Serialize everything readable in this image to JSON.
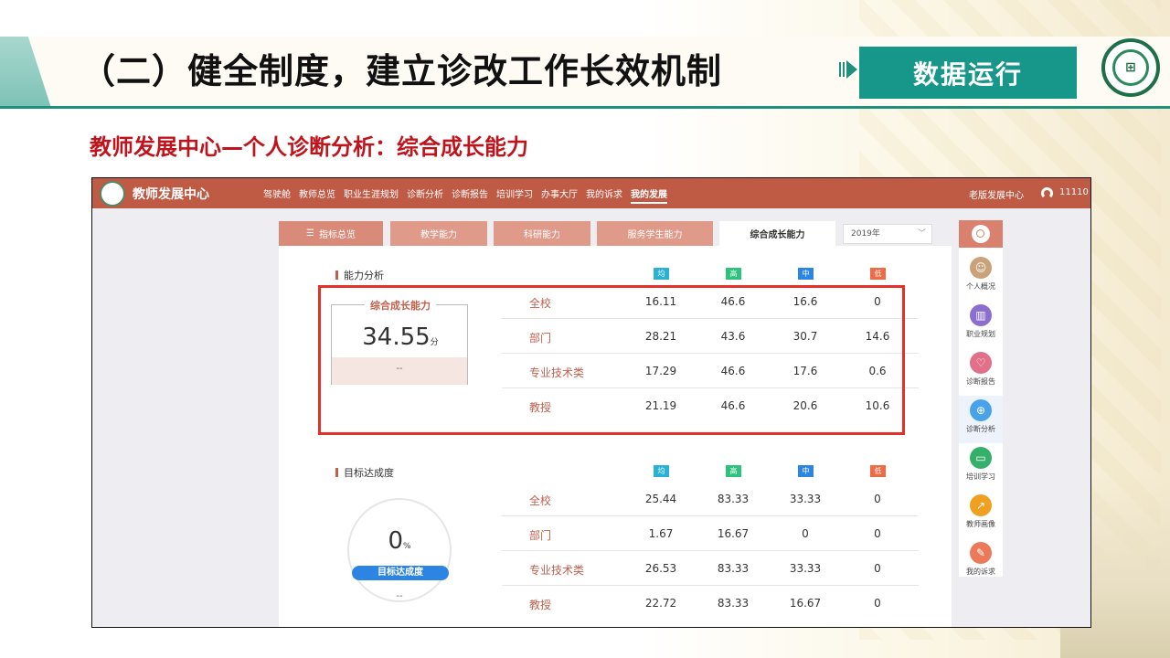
{
  "slide": {
    "title": "（二）健全制度，建立诊改工作长效机制",
    "badge": "数据运行",
    "subtitle": "教师发展中心—个人诊断分析：综合成长能力"
  },
  "app": {
    "name": "教师发展中心",
    "nav": [
      "驾驶舱",
      "教师总览",
      "职业生涯规划",
      "诊断分析",
      "诊断报告",
      "培训学习",
      "办事大厅",
      "我的诉求",
      "我的发展"
    ],
    "nav_active": "我的发展",
    "old_version": "老版发展中心",
    "user_id": "11110"
  },
  "tabs": {
    "overview": "指标总览",
    "items": [
      "教学能力",
      "科研能力",
      "服务学生能力",
      "综合成长能力"
    ],
    "active": "综合成长能力",
    "year": "2019年"
  },
  "legend": {
    "avg": "均",
    "high": "高",
    "mid": "中",
    "low": "低",
    "colors": {
      "avg": "#2bb0d6",
      "high": "#2ec27e",
      "mid": "#2d85e3",
      "low": "#ef6b46"
    }
  },
  "ability": {
    "section_title": "能力分析",
    "box_title": "综合成长能力",
    "score": "34.55",
    "unit": "分",
    "footnote": "--",
    "rows": [
      {
        "label": "全校",
        "avg": "16.11",
        "high": "46.6",
        "mid": "16.6",
        "low": "0"
      },
      {
        "label": "部门",
        "avg": "28.21",
        "high": "43.6",
        "mid": "30.7",
        "low": "14.6"
      },
      {
        "label": "专业技术类",
        "avg": "17.29",
        "high": "46.6",
        "mid": "17.6",
        "low": "0.6"
      },
      {
        "label": "教授",
        "avg": "21.19",
        "high": "46.6",
        "mid": "20.6",
        "low": "10.6"
      }
    ]
  },
  "goal": {
    "section_title": "目标达成度",
    "value": "0",
    "unit": "%",
    "pill": "目标达成度",
    "footnote": "--",
    "rows": [
      {
        "label": "全校",
        "avg": "25.44",
        "high": "83.33",
        "mid": "33.33",
        "low": "0"
      },
      {
        "label": "部门",
        "avg": "1.67",
        "high": "16.67",
        "mid": "0",
        "low": "0"
      },
      {
        "label": "专业技术类",
        "avg": "26.53",
        "high": "83.33",
        "mid": "33.33",
        "low": "0"
      },
      {
        "label": "教授",
        "avg": "22.72",
        "high": "83.33",
        "mid": "16.67",
        "low": "0"
      }
    ]
  },
  "sidebar": {
    "items": [
      {
        "label": "个人概况",
        "icon": "person-icon",
        "color": "#c9a27a"
      },
      {
        "label": "职业规划",
        "icon": "book-icon",
        "color": "#8a6fd1"
      },
      {
        "label": "诊断报告",
        "icon": "heart-icon",
        "color": "#e2708a"
      },
      {
        "label": "诊断分析",
        "icon": "target-icon",
        "color": "#4aa3e8"
      },
      {
        "label": "培训学习",
        "icon": "open-book-icon",
        "color": "#35b06a"
      },
      {
        "label": "教师画像",
        "icon": "trend-icon",
        "color": "#f0a020"
      },
      {
        "label": "我的诉求",
        "icon": "edit-icon",
        "color": "#ec7a5a"
      }
    ],
    "active": "诊断分析"
  }
}
